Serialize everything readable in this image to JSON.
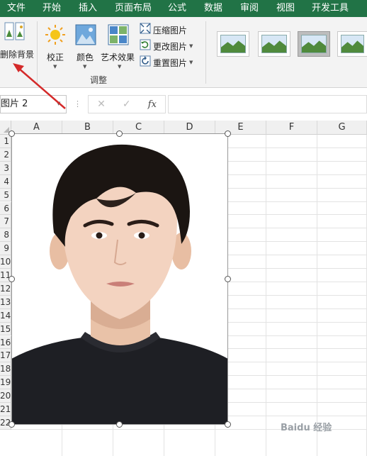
{
  "tabs": [
    "文件",
    "开始",
    "插入",
    "页面布局",
    "公式",
    "数据",
    "审阅",
    "视图",
    "开发工具"
  ],
  "ribbon": {
    "remove_bg": "删除背景",
    "corrections": "校正",
    "color": "颜色",
    "artistic": "艺术效果",
    "compress": "压缩图片",
    "change": "更改图片",
    "reset": "重置图片",
    "group_adjust": "调整"
  },
  "formula_bar": {
    "name_box": "图片 2",
    "cancel_icon": "✕",
    "enter_icon": "✓",
    "fx": "fx",
    "formula": ""
  },
  "grid": {
    "columns": [
      "A",
      "B",
      "C",
      "D",
      "E",
      "F",
      "G"
    ],
    "rows": [
      "1",
      "2",
      "3",
      "4",
      "5",
      "6",
      "7",
      "8",
      "9",
      "10",
      "11",
      "12",
      "13",
      "14",
      "15",
      "16",
      "17",
      "18",
      "19",
      "20",
      "21",
      "22"
    ]
  },
  "watermark": "Baidu 经验",
  "colors": {
    "tab_bar": "#217346",
    "accent": "#217346",
    "arrow": "#d42a2a"
  }
}
